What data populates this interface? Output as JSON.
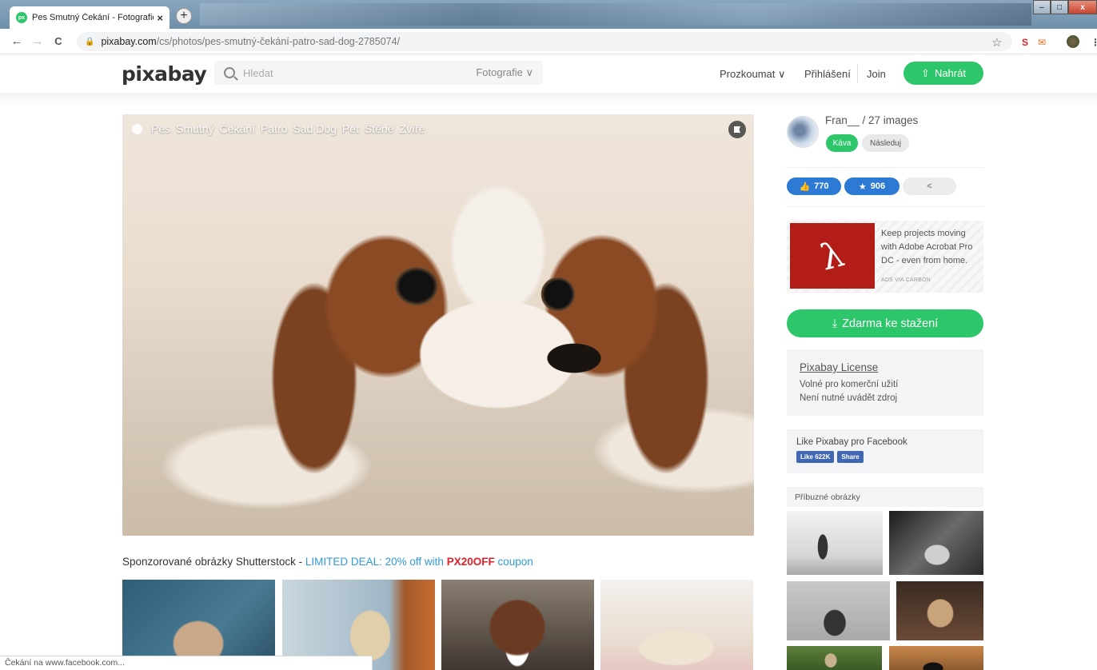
{
  "browser": {
    "tab_title": "Pes Smutný Čekání - Fotografie z",
    "tab_close": "×",
    "favicon_text": "px",
    "new_tab": "+",
    "nav": {
      "back": "←",
      "forward": "→",
      "reload": "C"
    },
    "url_host": "pixabay.com",
    "url_path": "/cs/photos/pes-smutný-čekání-patro-sad-dog-2785074/",
    "bookmark_star": "☆",
    "window_controls": [
      "–",
      "□",
      "x"
    ],
    "extensions": [
      "S",
      "✉",
      "⋮"
    ],
    "status_text": "Čekání na www.facebook.com..."
  },
  "header": {
    "logo": "pixabay",
    "search_placeholder": "Hledat",
    "search_type": "Fotografie ∨",
    "explore": "Prozkoumat ∨",
    "login": "Přihlášení",
    "join": "Join",
    "upload": "Nahrát"
  },
  "photo": {
    "tags": [
      "Pes",
      "Smutný",
      "Čekání",
      "Patro",
      "Sad Dog",
      "Pet",
      "Štěně",
      "Zvíře"
    ]
  },
  "sponsored": {
    "prefix": "Sponzorované obrázky Shutterstock - ",
    "deal": "LIMITED DEAL: 20% off with ",
    "code": "PX20OFF",
    "suffix": " coupon"
  },
  "author": {
    "name": "Fran__ / 27 images",
    "coffee": "Káva",
    "follow": "Následuj"
  },
  "stats": {
    "likes": "770",
    "favorites": "906"
  },
  "ad": {
    "text": "Keep projects moving with Adobe Acrobat Pro DC - even from home.",
    "via": "ADS VIA CARBON"
  },
  "download": {
    "label": "Zdarma ke stažení"
  },
  "license": {
    "title": "Pixabay License",
    "line1": "Volné pro komerční užití",
    "line2": "Není nutné uvádět zdroj"
  },
  "facebook": {
    "text": "Like Pixabay pro Facebook",
    "like": "Like 622K",
    "share": "Share"
  },
  "related": {
    "title": "Příbuzné obrázky"
  },
  "colors": {
    "brand_green": "#2ec66b",
    "stat_blue": "#2c7ad3",
    "deal_blue": "#2e9ad8",
    "code_red": "#e0202a"
  }
}
